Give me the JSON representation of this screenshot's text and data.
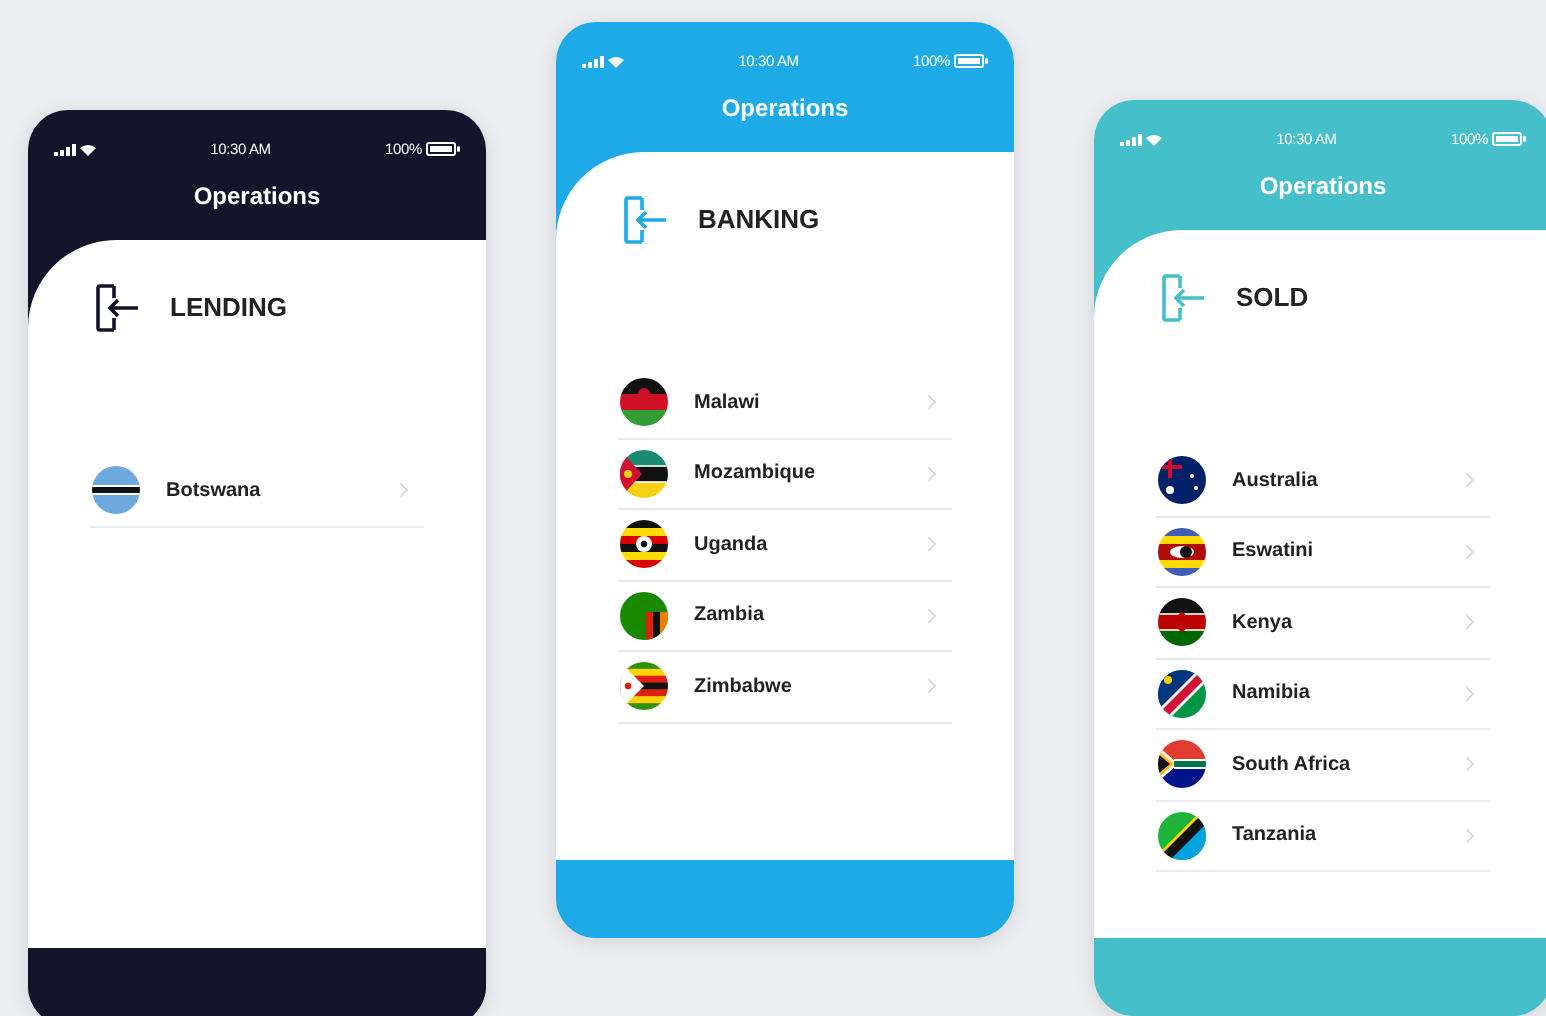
{
  "phones": [
    {
      "color": "#14152b",
      "time": "10:30 AM",
      "battery": "100%",
      "title": "Operations",
      "section": "LENDING",
      "rows": [
        {
          "label": "Botswana"
        }
      ]
    },
    {
      "color": "#1eaae7",
      "time": "10:30 AM",
      "battery": "100%",
      "title": "Operations",
      "section": "BANKING",
      "rows": [
        {
          "label": "Malawi"
        },
        {
          "label": "Mozambique"
        },
        {
          "label": "Uganda"
        },
        {
          "label": "Zambia"
        },
        {
          "label": "Zimbabwe"
        }
      ]
    },
    {
      "color": "#45bfca",
      "time": "10:30 AM",
      "battery": "100%",
      "title": "Operations",
      "section": "SOLD",
      "rows": [
        {
          "label": "Australia"
        },
        {
          "label": "Eswatini"
        },
        {
          "label": "Kenya"
        },
        {
          "label": "Namibia"
        },
        {
          "label": "South Africa"
        },
        {
          "label": "Tanzania"
        }
      ]
    }
  ]
}
